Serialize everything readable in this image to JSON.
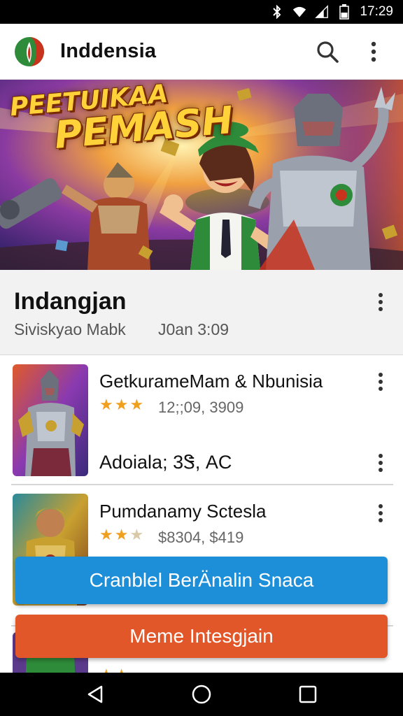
{
  "status_bar": {
    "time": "17:29",
    "icons": [
      "bluetooth-icon",
      "wifi-icon",
      "signal-icon",
      "battery-icon"
    ]
  },
  "app_bar": {
    "title": "Inddensia",
    "actions": [
      "search-icon",
      "more-vert-icon"
    ]
  },
  "hero": {
    "title_line1": "PEETUIKAA",
    "title_line2": "PEMASH"
  },
  "section": {
    "title": "Indangjan",
    "subtitle": "Siviskyao Mabk",
    "date": "J0an 3:09"
  },
  "list": {
    "items": [
      {
        "title": "GetkurameMam & Nbunisia",
        "rating": 3,
        "rating_max": 3,
        "meta": "12;;09, 3909",
        "subtitle": "Adoiala; 3Ꮥ, AC"
      },
      {
        "title": "Pumdanamy Sctesla",
        "rating": 2.5,
        "rating_max": 3,
        "meta": "$8304, $419",
        "subtitle": ""
      }
    ]
  },
  "buttons": {
    "primary_label": "Cranblel BerÄnalin Snaca",
    "secondary_label": "Meme Intesgjain"
  },
  "colors": {
    "primary_button": "#1d8fd8",
    "secondary_button": "#e2572a",
    "star": "#f0a020",
    "status_bar": "#000000"
  },
  "nav_bar": {
    "buttons": [
      "back-icon",
      "home-icon",
      "recents-icon"
    ]
  }
}
